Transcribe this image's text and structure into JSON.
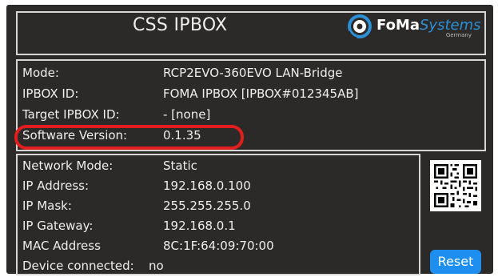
{
  "header": {
    "title": "CSS IPBOX",
    "logo": {
      "brand_bold": "FoMa",
      "brand_light": "Systems",
      "sub": "Germany",
      "accent": "#2d8fd6"
    }
  },
  "info": {
    "mode_label": "Mode:",
    "mode_value": "RCP2EVO-360EVO LAN-Bridge",
    "ipbox_id_label": "IPBOX ID:",
    "ipbox_id_value": "FOMA IPBOX [IPBOX#012345AB]",
    "target_label": "Target IPBOX ID:",
    "target_value": "- [none]",
    "software_label": "Software Version:",
    "software_value": "0.1.35"
  },
  "network": {
    "mode_label": "Network Mode:",
    "mode_value": "Static",
    "ip_label": "IP Address:",
    "ip_value": "192.168.0.100",
    "mask_label": "IP Mask:",
    "mask_value": "255.255.255.0",
    "gateway_label": "IP Gateway:",
    "gateway_value": "192.168.0.1",
    "mac_label": "MAC Address",
    "mac_value": "8C:1F:64:09:70:00",
    "device_label": "Device connected:",
    "device_value": "no"
  },
  "qr": {
    "icon": "qr-code-icon"
  },
  "buttons": {
    "reset_label": "Reset",
    "reset_color": "#1e8ef0"
  },
  "highlight": {
    "color": "#e21d1d"
  }
}
